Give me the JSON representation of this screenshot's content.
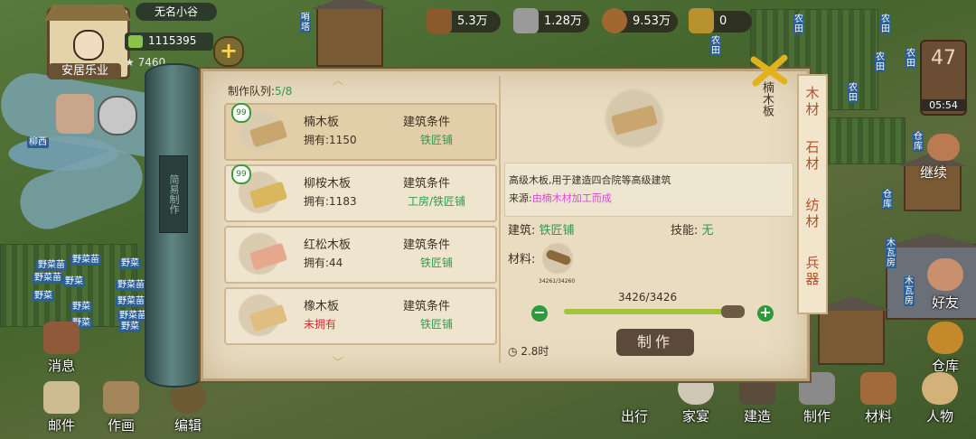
{
  "player": {
    "village_name": "无名小谷",
    "title_banner": "安居乐业",
    "power": "1115395",
    "rating": "7460",
    "rating_suffix": "60"
  },
  "resources": [
    {
      "icon": "wood-log-icon",
      "value": "5.3万"
    },
    {
      "icon": "stone-icon",
      "value": "1.28万"
    },
    {
      "icon": "coin-icon",
      "value": "9.53万"
    },
    {
      "icon": "ticket-icon",
      "value": "0"
    }
  ],
  "clock": {
    "day": "47",
    "time": "05:54"
  },
  "map_labels": {
    "river": "柳西",
    "left_fields": [
      "野菜苗",
      "野菜苗",
      "野菜",
      "野菜",
      "野菜苗",
      "野菜",
      "野菜苗",
      "野菜",
      "野菜苗",
      "野菜",
      "野菜苗",
      "野菜"
    ],
    "right_fields": [
      "农田",
      "农田",
      "农田",
      "农田",
      "农田",
      "农田"
    ],
    "storage": "仓库",
    "shed": "木瓦房",
    "shed2": "木瓦房",
    "pavilion": "哨塔",
    "continue_label": "继续"
  },
  "left_nav": [
    {
      "icon": "message-icon",
      "label": "消息"
    },
    {
      "icon": "mail-icon",
      "label": "邮件"
    },
    {
      "icon": "painting-icon",
      "label": "作画"
    },
    {
      "icon": "edit-icon",
      "label": "编辑"
    }
  ],
  "right_side": [
    {
      "icon": "friends-icon",
      "label": "好友"
    },
    {
      "icon": "warehouse-icon",
      "label": "仓库"
    }
  ],
  "bottom_nav": [
    {
      "icon": "travel-icon",
      "label": "出行"
    },
    {
      "icon": "banquet-icon",
      "label": "家宴"
    },
    {
      "icon": "build-icon",
      "label": "建造"
    },
    {
      "icon": "craft-icon",
      "label": "制作"
    },
    {
      "icon": "material-icon",
      "label": "材料"
    },
    {
      "icon": "people-icon",
      "label": "人物"
    }
  ],
  "scroll_tag": "简易制作",
  "craft": {
    "queue_label": "制作队列:",
    "queue_value": "5/8",
    "items": [
      {
        "name": "楠木板",
        "own": "拥有:1150",
        "cond": "建筑条件",
        "req": "铁匠铺",
        "level": "99",
        "color": "#c9a66d",
        "owned": true
      },
      {
        "name": "柳桉木板",
        "own": "拥有:1183",
        "cond": "建筑条件",
        "req": "工房/铁匠铺",
        "level": "99",
        "color": "#d9b75c",
        "owned": true
      },
      {
        "name": "红松木板",
        "own": "拥有:44",
        "cond": "建筑条件",
        "req": "铁匠铺",
        "level": "",
        "color": "#e7a98e",
        "owned": true
      },
      {
        "name": "橡木板",
        "own": "未拥有",
        "cond": "建筑条件",
        "req": "铁匠铺",
        "level": "",
        "color": "#e0be82",
        "owned": false
      }
    ],
    "detail": {
      "title": "楠木板",
      "desc": "高级木板,用于建造四合院等高级建筑",
      "source_label": "来源:",
      "source_value": "由楠木材加工而成",
      "building_label": "建筑:",
      "building_value": "铁匠铺",
      "skill_label": "技能:",
      "skill_value": "无",
      "material_label": "材料:",
      "material_count": "3426/3426",
      "material_small": "34261/34260",
      "time": "2.8时",
      "make_button": "制作"
    },
    "tabs": [
      "木材",
      "石材",
      "纺材",
      "兵器"
    ],
    "accent": "#2e9b4e"
  }
}
